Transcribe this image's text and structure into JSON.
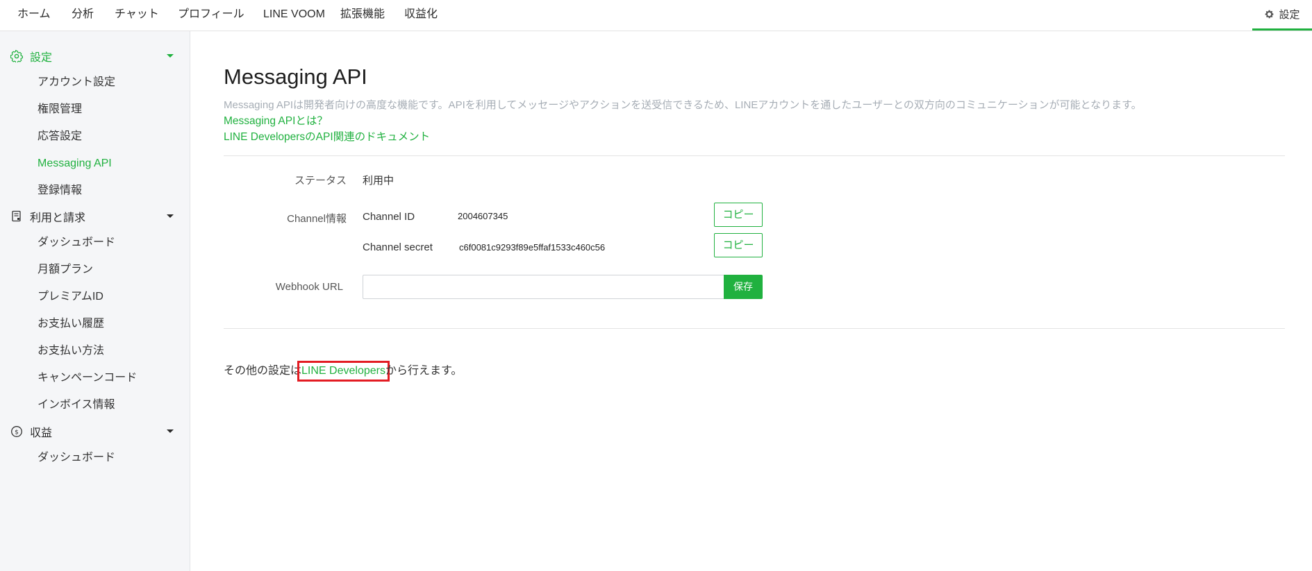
{
  "topnav": {
    "items": [
      "ホーム",
      "分析",
      "チャット",
      "プロフィール",
      "LINE VOOM",
      "拡張機能",
      "収益化"
    ],
    "settings_label": "設定"
  },
  "sidebar": {
    "sections": [
      {
        "label": "設定",
        "icon": "gear-icon",
        "items": [
          "アカウント設定",
          "権限管理",
          "応答設定",
          "Messaging API",
          "登録情報"
        ]
      },
      {
        "label": "利用と請求",
        "icon": "billing-icon",
        "items": [
          "ダッシュボード",
          "月額プラン",
          "プレミアムID",
          "お支払い履歴",
          "お支払い方法",
          "キャンペーンコード",
          "インボイス情報"
        ]
      },
      {
        "label": "収益",
        "icon": "coin-icon",
        "items": [
          "ダッシュボード"
        ]
      }
    ],
    "active_item": "Messaging API"
  },
  "main": {
    "title": "Messaging API",
    "description": "Messaging APIは開発者向けの高度な機能です。APIを利用してメッセージやアクションを送受信できるため、LINEアカウントを通したユーザーとの双方向のコミュニケーションが可能となります。",
    "link_about": "Messaging APIとは？",
    "link_docs": "LINE DevelopersのAPI関連のドキュメント",
    "status_label": "ステータス",
    "status_value": "利用中",
    "channel_label": "Channel情報",
    "channel_id_label": "Channel ID",
    "channel_id": "2004607345",
    "channel_secret_label": "Channel secret",
    "channel_secret": "c6f0081c9293f89e5ffaf1533c460c56",
    "copy_label": "コピー",
    "webhook_label": "Webhook URL",
    "webhook_value": "",
    "save_label": "保存",
    "footer_prefix": "その他の設定は",
    "footer_link": "LINE Developers",
    "footer_suffix": "から行えます。"
  },
  "colors": {
    "accent": "#20b13f",
    "highlight": "#e31c23"
  }
}
